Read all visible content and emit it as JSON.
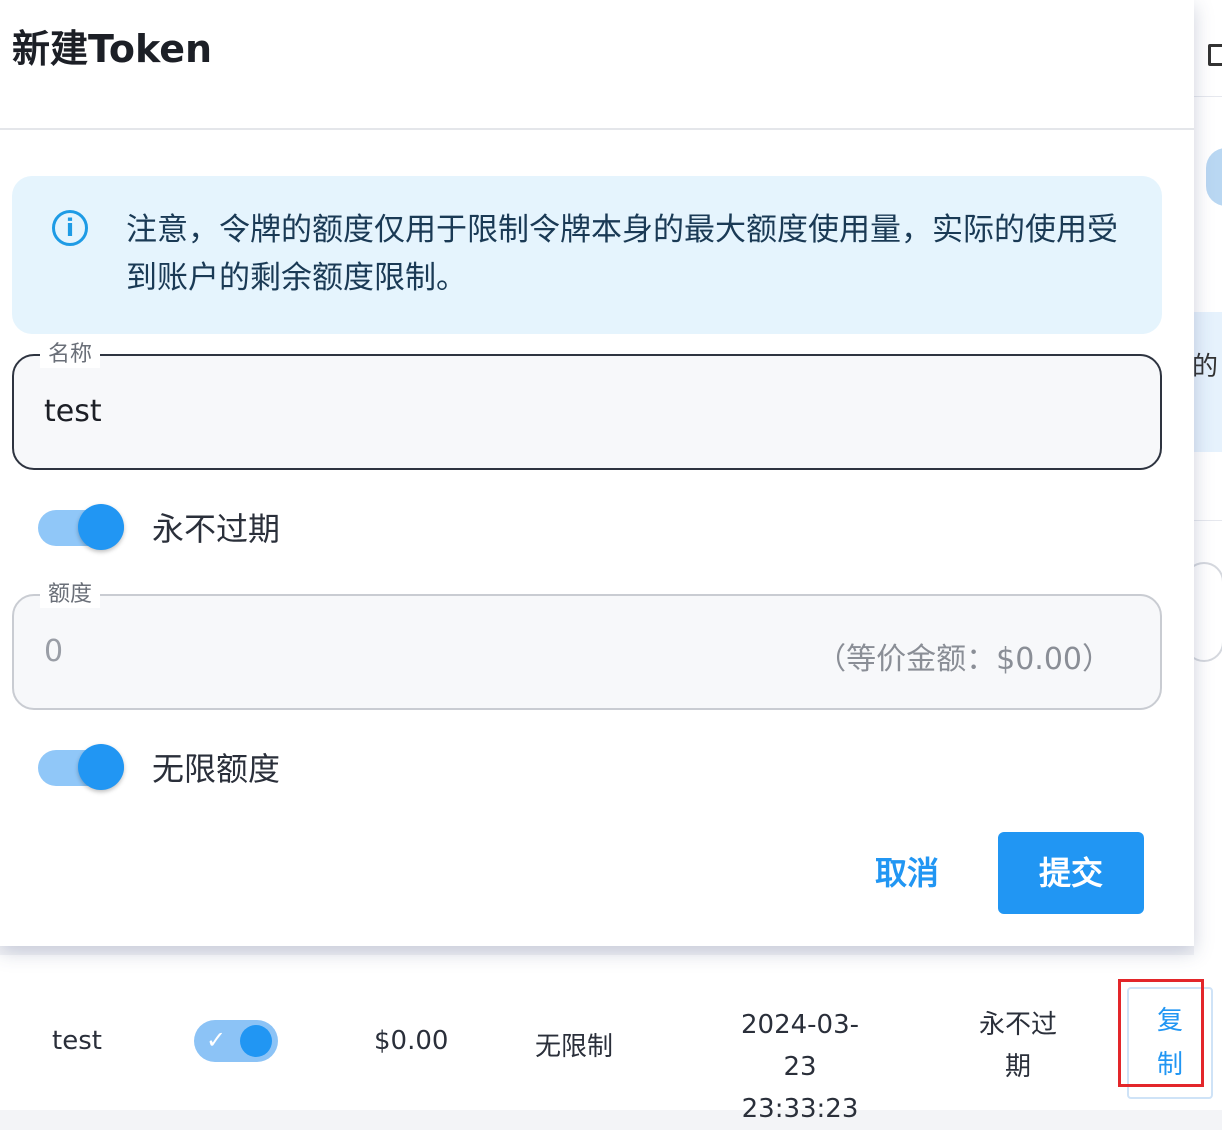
{
  "dialog": {
    "title": "新建Token",
    "alert": {
      "icon": "info-icon",
      "text": "注意，令牌的额度仅用于限制令牌本身的最大额度使用量，实际的使用受到账户的剩余额度限制。"
    },
    "name_field": {
      "label": "名称",
      "value": "test"
    },
    "never_expire": {
      "label": "永不过期",
      "enabled": true
    },
    "quota_field": {
      "label": "额度",
      "value": "0",
      "suffix": "（等价金额：$0.00）"
    },
    "unlimited": {
      "label": "无限额度",
      "enabled": true
    },
    "actions": {
      "cancel": "取消",
      "submit": "提交"
    }
  },
  "background": {
    "fragment_text": "的",
    "token_row": {
      "name": "test",
      "status_enabled": true,
      "used": "$0.00",
      "quota": "无限制",
      "created_date": "2024-03-23",
      "created_time": "23:33:23",
      "expire": "永不过期",
      "copy_label": "复制"
    }
  },
  "colors": {
    "accent": "#2196f3",
    "alert_bg": "#e5f4fd",
    "highlight": "#e3262a"
  }
}
